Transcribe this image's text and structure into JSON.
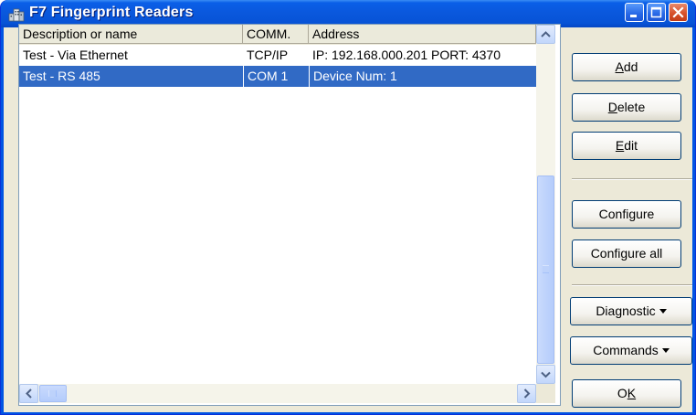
{
  "window": {
    "title": "F7 Fingerprint Readers",
    "title_icon": "fingerprint-app-icon",
    "minimize_icon": "minimize-icon",
    "maximize_icon": "maximize-icon",
    "close_icon": "close-icon"
  },
  "list": {
    "columns": [
      "Description or name",
      "COMM.",
      "Address"
    ],
    "rows": [
      {
        "name": "Test - Via Ethernet",
        "comm": "TCP/IP",
        "address": "IP: 192.168.000.201  PORT: 4370",
        "selected": false
      },
      {
        "name": "Test - RS 485",
        "comm": "COM 1",
        "address": "Device Num: 1",
        "selected": true
      }
    ]
  },
  "buttons": {
    "add": {
      "mnemonic": "A",
      "rest": "dd"
    },
    "delete": {
      "mnemonic": "D",
      "rest": "elete"
    },
    "edit": {
      "mnemonic": "E",
      "rest": "dit"
    },
    "configure": "Configure",
    "configure_all": "Configure all",
    "diagnostic": "Diagnostic",
    "commands": "Commands",
    "ok": {
      "prefix": "O",
      "mnemonic": "K"
    }
  },
  "colors": {
    "titlebar": "#0a58dd",
    "selection": "#316ac5",
    "dialog_bg": "#ece9d8",
    "close_button": "#d7522b"
  }
}
